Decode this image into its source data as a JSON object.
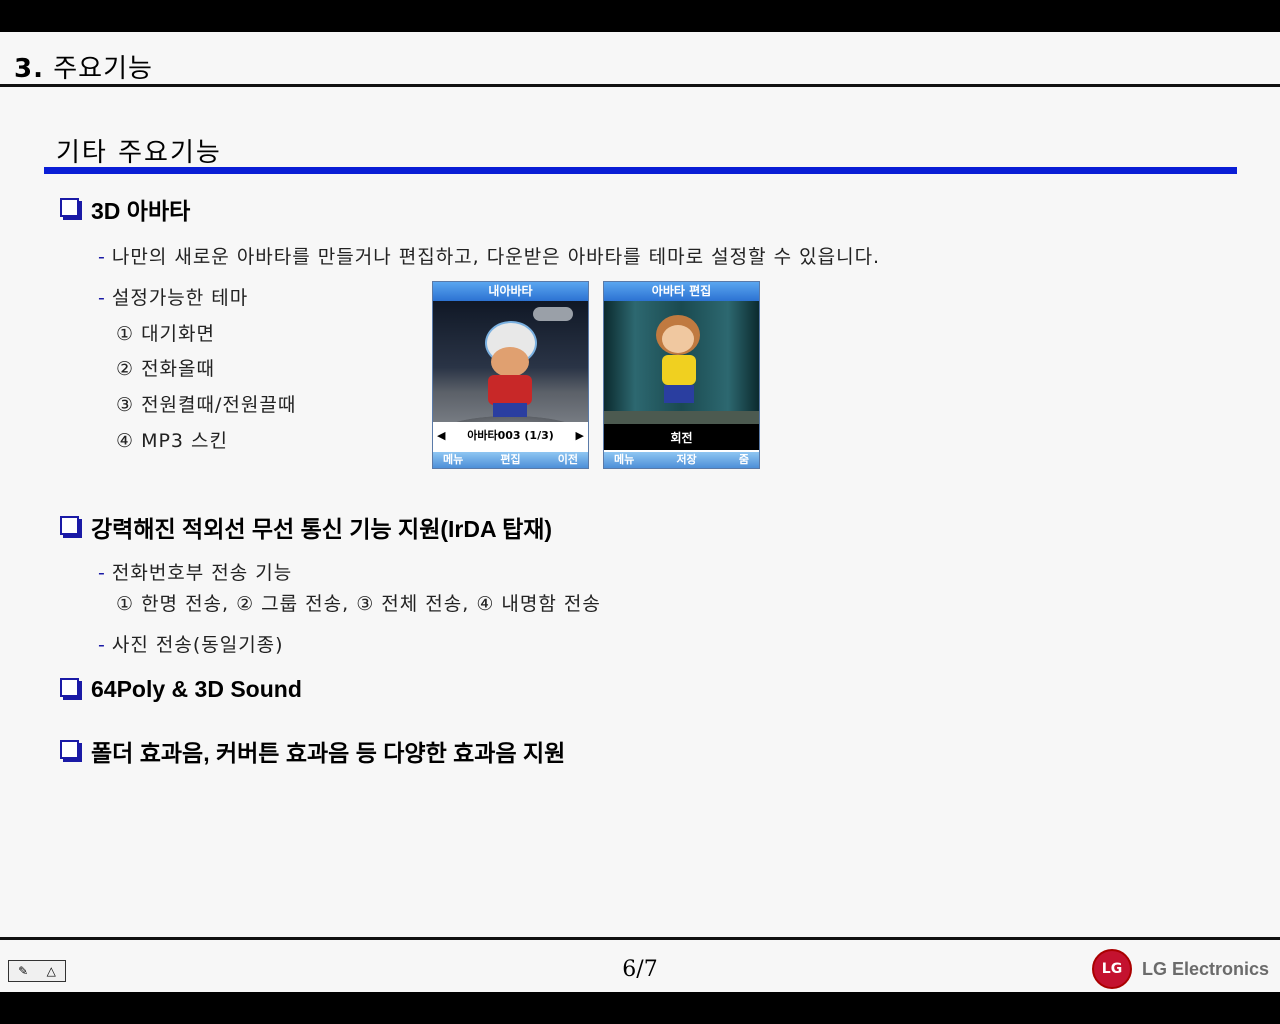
{
  "header": {
    "num": "3.",
    "title": "주요기능"
  },
  "section_title": "기타 주요기능",
  "bullets": {
    "avatar": "3D 아바타",
    "irda": "강력해진 적외선 무선 통신 기능 지원(IrDA 탑재)",
    "sound": "64Poly & 3D Sound",
    "effects": "폴더 효과음, 커버튼 효과음 등 다양한 효과음 지원"
  },
  "avatar": {
    "desc": "나만의 새로운 아바타를 만들거나 편집하고, 다운받은 아바타를 테마로 설정할 수 있읍니다.",
    "themes_label": "설정가능한 테마",
    "themes": [
      "① 대기화면",
      "② 전화올때",
      "③ 전원켤때/전원끌때",
      "④ MP3 스킨"
    ]
  },
  "irda": {
    "phonebook_label": "전화번호부 전송 기능",
    "phonebook_items": "① 한명 전송, ② 그룹 전송, ③ 전체 전송, ④ 내명함 전송",
    "photo_label": "사진 전송(동일기종)"
  },
  "phone1": {
    "title": "내아바타",
    "status": "아바타003 (1/3)",
    "soft": [
      "메뉴",
      "편집",
      "이전"
    ]
  },
  "phone2": {
    "title": "아바타 편집",
    "status": "회전",
    "soft": [
      "메뉴",
      "저장",
      "줌"
    ]
  },
  "footer": {
    "page": "6/7",
    "brand": "LG Electronics",
    "logo_mark": "LG"
  },
  "colors": {
    "accent_blue": "#0a1ed6",
    "bullet_blue": "#1a1aa6",
    "lg_red": "#c4122f"
  }
}
